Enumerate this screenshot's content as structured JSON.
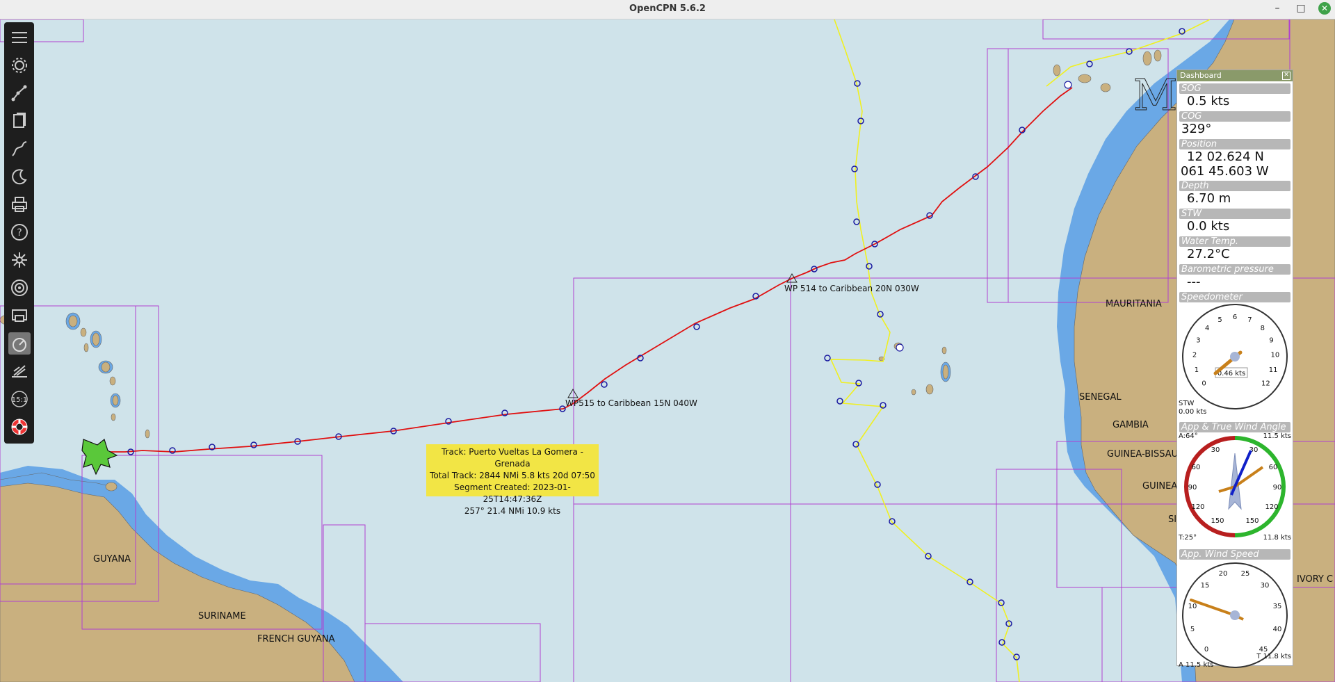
{
  "window": {
    "title": "OpenCPN 5.6.2"
  },
  "map_labels": {
    "mauritania": "MAURITANIA",
    "senegal": "SENEGAL",
    "gambia": "GAMBIA",
    "guinea_bissau": "GUINEA-BISSAU",
    "guinea": "GUINEA",
    "sierra": "SI",
    "ivory": "IVORY C",
    "guyana": "GUYANA",
    "suriname": "SURINAME",
    "french_guyana": "FRENCH GUYANA",
    "wp514": "WP 514 to Caribbean 20N 030W",
    "wp515": "WP515 to Caribbean 15N 040W"
  },
  "track_tooltip": {
    "line1": "Track: Puerto Vueltas La Gomera - Grenada",
    "line2": "Total Track: 2844 NMi  5.8 kts  20d 07:50",
    "line3": "Segment Created: 2023-01-25T14:47:36Z",
    "line4": "257° 21.4 NMi  10.9 kts"
  },
  "toolbar": {
    "icons": [
      "menu-icon",
      "settings-icon",
      "route-icon",
      "document-icon",
      "track-icon",
      "night-mode-icon",
      "print-icon",
      "help-icon",
      "ais-icon",
      "radar-icon",
      "dashboard-icon",
      "dashboard-active-icon",
      "tide-icon",
      "scale-icon",
      "lifebuoy-icon"
    ],
    "scale_label": "15:1"
  },
  "dashboard": {
    "title": "Dashboard",
    "sog_label": "SOG",
    "sog_value": "0.5 kts",
    "cog_label": "COG",
    "cog_value": "329°",
    "position_label": "Position",
    "lat": "12 02.624 N",
    "lon": "061 45.603 W",
    "depth_label": "Depth",
    "depth_value": "6.70 m",
    "stw_label": "STW",
    "stw_value": "0.0 kts",
    "water_label": "Water Temp.",
    "water_value": "27.2°C",
    "baro_label": "Barometric pressure",
    "baro_value": "---",
    "speedo_label": "Speedometer",
    "speedo_ticks": [
      "0",
      "1",
      "2",
      "3",
      "4",
      "5",
      "6",
      "7",
      "8",
      "9",
      "10",
      "11",
      "12"
    ],
    "speedo_readout": "0.46 kts",
    "speedo_stw": "STW",
    "speedo_stw_val": "0.00 kts",
    "speedo_value": 0.46,
    "wind_angle_label": "App & True Wind Angle",
    "wind_a_angle": "A:64°",
    "wind_a_speed": "11.5 kts",
    "wind_t_angle": "T:25°",
    "wind_t_speed": "11.8 kts",
    "wind_ticks": [
      "30",
      "60",
      "90",
      "120",
      "150",
      "150",
      "120",
      "90",
      "60",
      "30"
    ],
    "app_wind_label": "App. Wind Speed",
    "aws_ticks": [
      "0",
      "5",
      "10",
      "15",
      "20",
      "25",
      "30",
      "35",
      "40",
      "45"
    ],
    "aws_a": "A 11.5 kts",
    "aws_t": "T 11.8 kts"
  },
  "colors": {
    "sea": "#cfe3ea",
    "shallow": "#6aa8e6",
    "land": "#c9b07f",
    "track": "#e01010",
    "route": "#f0f020",
    "chart_border": "#b040d0"
  },
  "watermark": "M  S"
}
